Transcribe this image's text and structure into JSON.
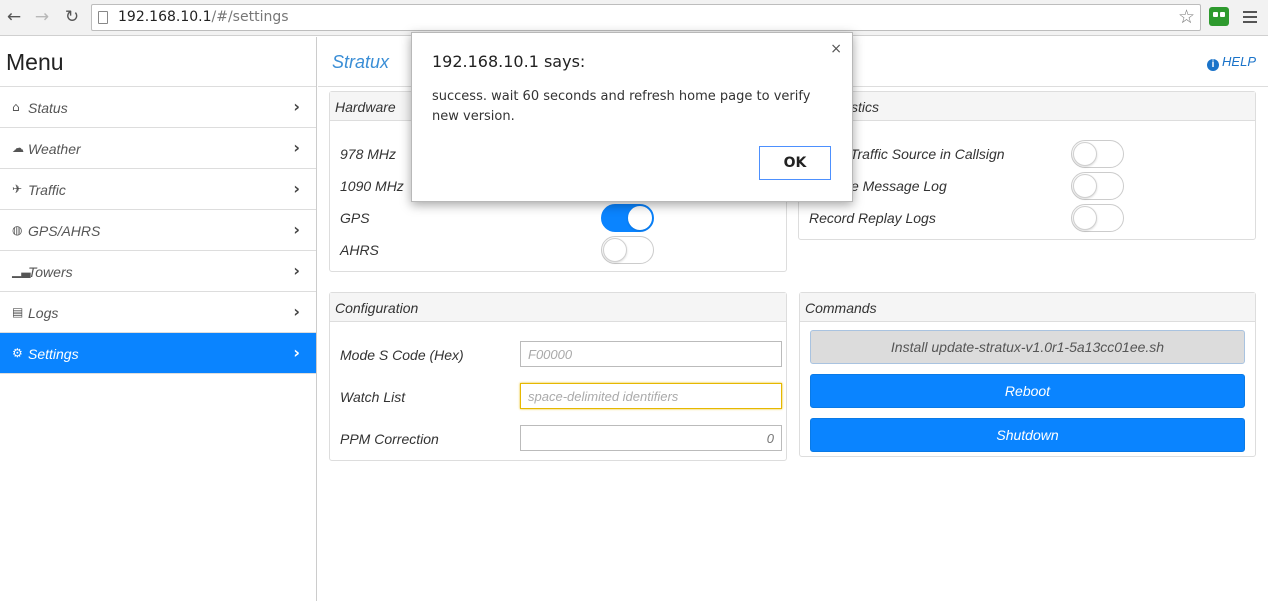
{
  "browser": {
    "back_icon": "arrow-left-icon",
    "forward_icon": "arrow-right-icon",
    "reload_icon": "reload-icon",
    "url_host": "192.168.10.1",
    "url_path": "/#/settings",
    "bookmark_icon": "star-icon"
  },
  "sidebar": {
    "title": "Menu",
    "items": [
      {
        "label": "Status",
        "icon": "home-icon"
      },
      {
        "label": "Weather",
        "icon": "cloud-icon"
      },
      {
        "label": "Traffic",
        "icon": "plane-icon"
      },
      {
        "label": "GPS/AHRS",
        "icon": "globe-icon"
      },
      {
        "label": "Towers",
        "icon": "signal-icon"
      },
      {
        "label": "Logs",
        "icon": "document-icon"
      },
      {
        "label": "Settings",
        "icon": "gear-icon",
        "active": true
      }
    ]
  },
  "header": {
    "brand": "Stratux",
    "help": "HELP"
  },
  "hardware": {
    "title": "Hardware",
    "rows": [
      {
        "label": "978 MHz"
      },
      {
        "label": "1090 MHz"
      },
      {
        "label": "GPS",
        "on": true
      },
      {
        "label": "AHRS",
        "on": false
      }
    ]
  },
  "diagnostics": {
    "title_fragment": "stics",
    "rows": [
      {
        "label": "Traffic Source in Callsign",
        "on": false
      },
      {
        "label": "e Message Log",
        "on": false
      },
      {
        "label": "Record Replay Logs",
        "on": false
      }
    ]
  },
  "configuration": {
    "title": "Configuration",
    "mode_s_label": "Mode S Code (Hex)",
    "mode_s_placeholder": "F00000",
    "watch_label": "Watch List",
    "watch_placeholder": "space-delimited identifiers",
    "ppm_label": "PPM Correction",
    "ppm_value": "0"
  },
  "commands": {
    "title": "Commands",
    "install_label": "Install update-stratux-v1.0r1-5a13cc01ee.sh",
    "reboot_label": "Reboot",
    "shutdown_label": "Shutdown"
  },
  "dialog": {
    "title": "192.168.10.1 says:",
    "message": "success. wait 60 seconds and refresh home page to verify new version.",
    "close": "×",
    "ok": "OK"
  }
}
